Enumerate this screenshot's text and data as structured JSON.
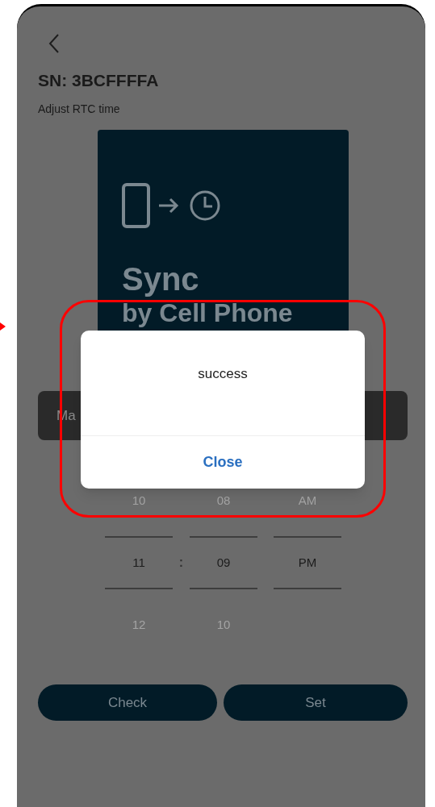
{
  "header": {
    "title": "SN: 3BCFFFFA",
    "subtitle": "Adjust RTC time"
  },
  "sync_card": {
    "title": "Sync",
    "subtitle": "by Cell Phone"
  },
  "mode_bar": {
    "label": "Ma"
  },
  "time_picker": {
    "separator": ":",
    "rows": [
      {
        "cells": [
          "10",
          "08",
          "AM"
        ],
        "selected": false
      },
      {
        "cells": [
          "11",
          "09",
          "PM"
        ],
        "selected": true
      },
      {
        "cells": [
          "12",
          "10"
        ],
        "selected": false
      }
    ]
  },
  "buttons": [
    {
      "label": "Check"
    },
    {
      "label": "Set"
    }
  ],
  "dialog": {
    "message": "success",
    "action": "Close"
  },
  "annotation": {
    "highlight": true
  }
}
